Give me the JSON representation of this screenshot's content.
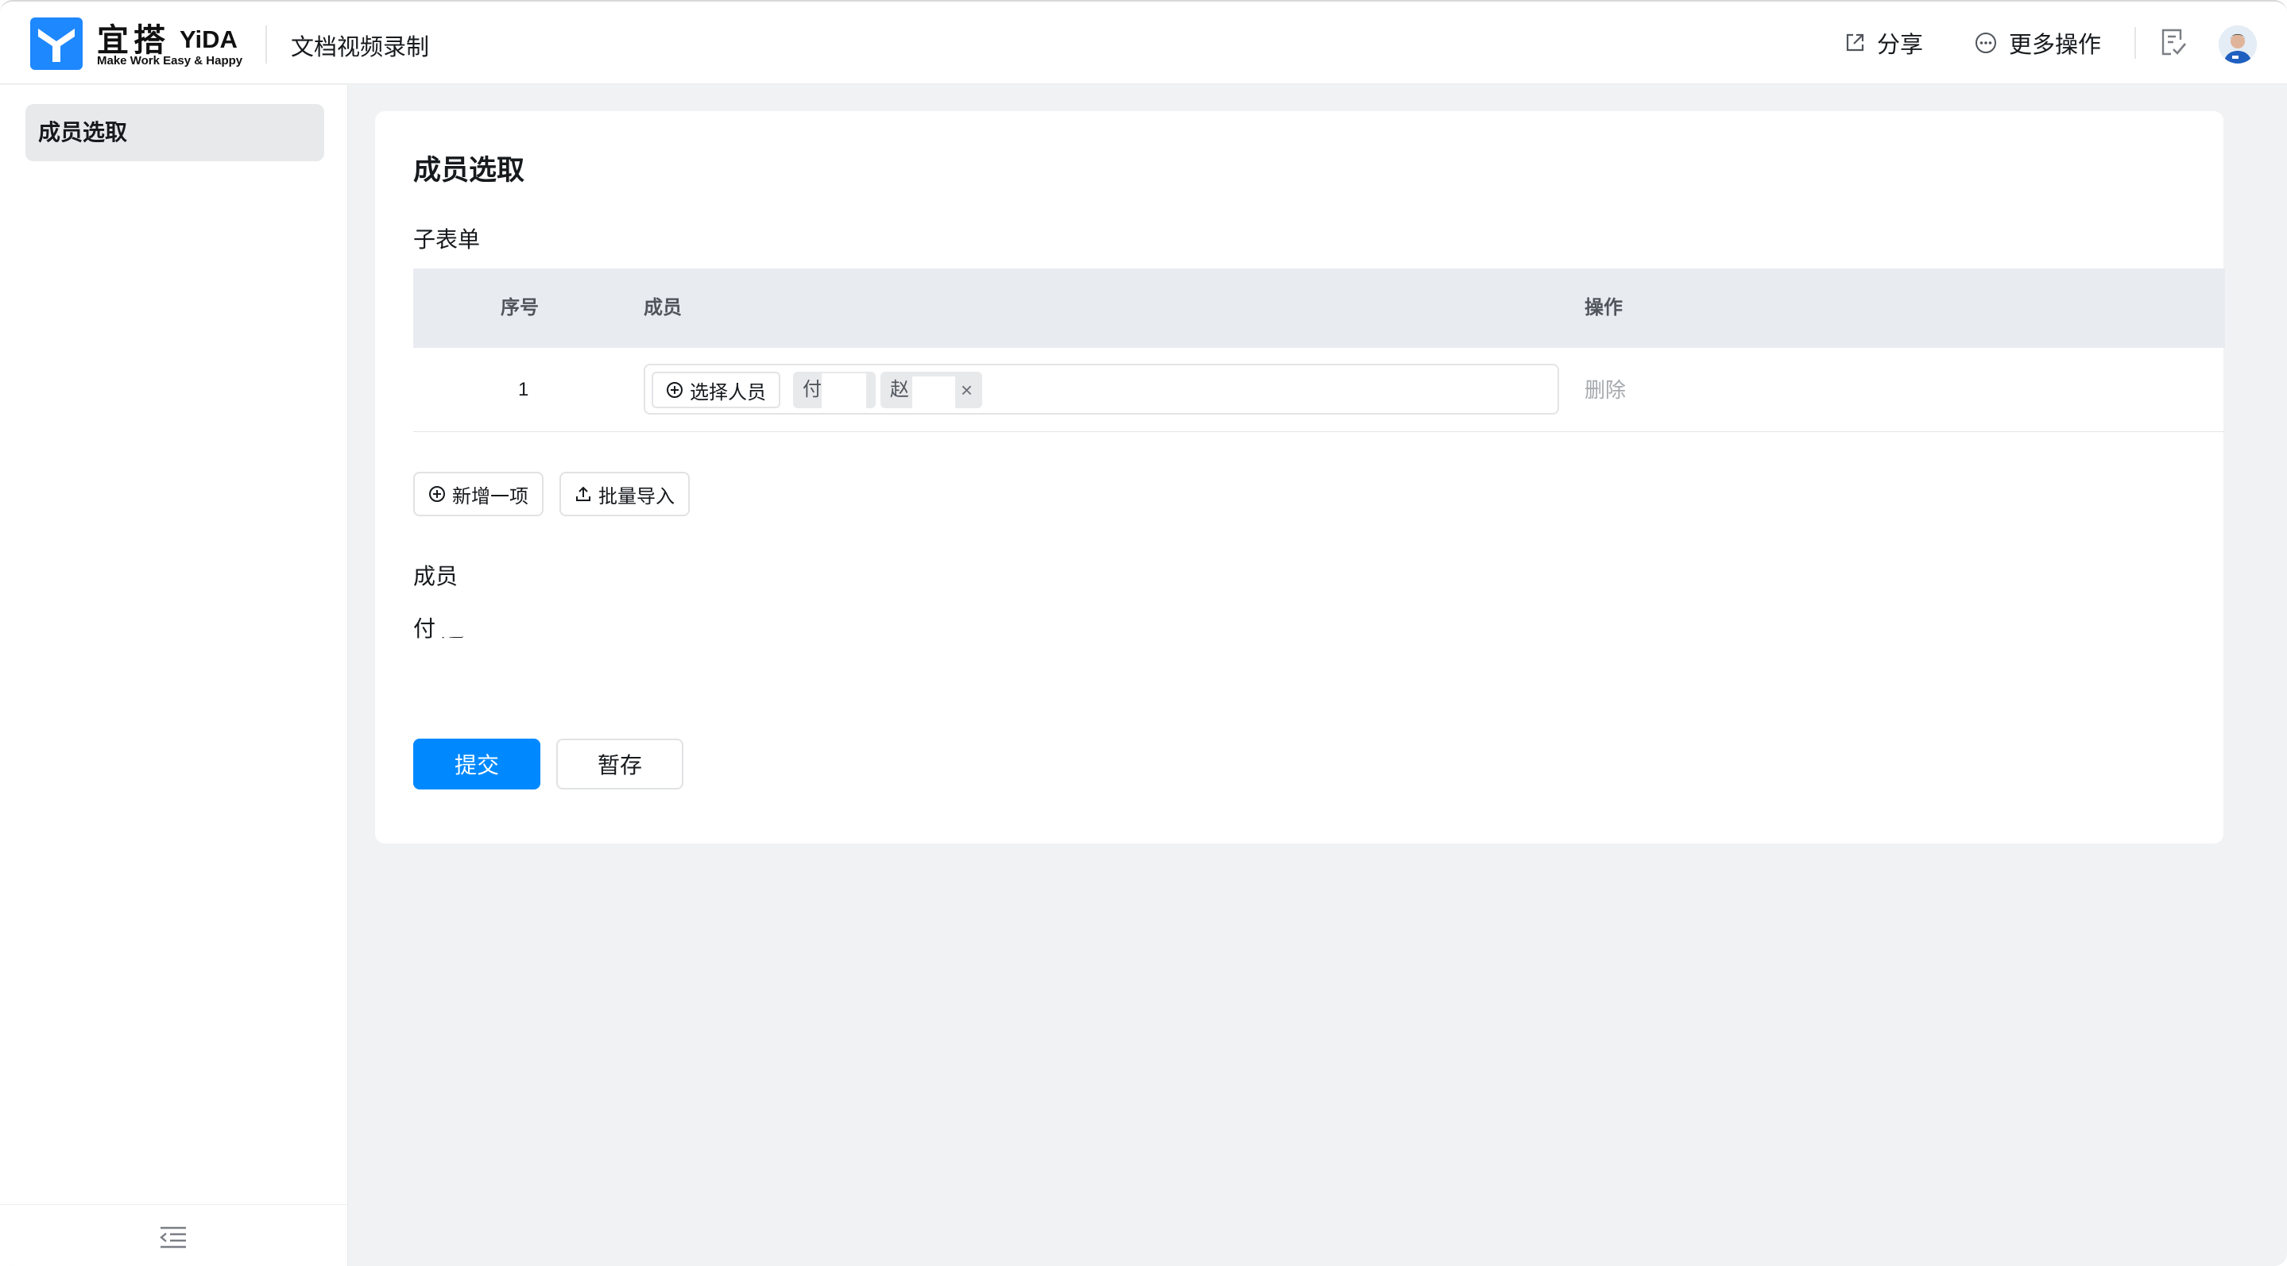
{
  "header": {
    "logo_cn": "宜搭",
    "logo_en": "YiDA",
    "logo_slogan": "Make Work Easy & Happy",
    "app_title": "文档视频录制",
    "share_label": "分享",
    "more_label": "更多操作",
    "brand_color": "#1e88ff"
  },
  "sidebar": {
    "items": [
      {
        "label": "成员选取",
        "active": true
      }
    ]
  },
  "form": {
    "title": "成员选取",
    "subform_label": "子表单",
    "table": {
      "columns": [
        "序号",
        "成员",
        "操作"
      ],
      "rows": [
        {
          "seq": "1",
          "pick_label": "选择人员",
          "tags": [
            "付",
            "赵"
          ],
          "close_glyph": "×",
          "delete_label": "删除"
        }
      ]
    },
    "add_label": "新增一项",
    "import_label": "批量导入",
    "member_field_label": "成员",
    "member_field_value": "付    赵",
    "submit_label": "提交",
    "save_label": "暂存",
    "primary_color": "#0089ff"
  }
}
